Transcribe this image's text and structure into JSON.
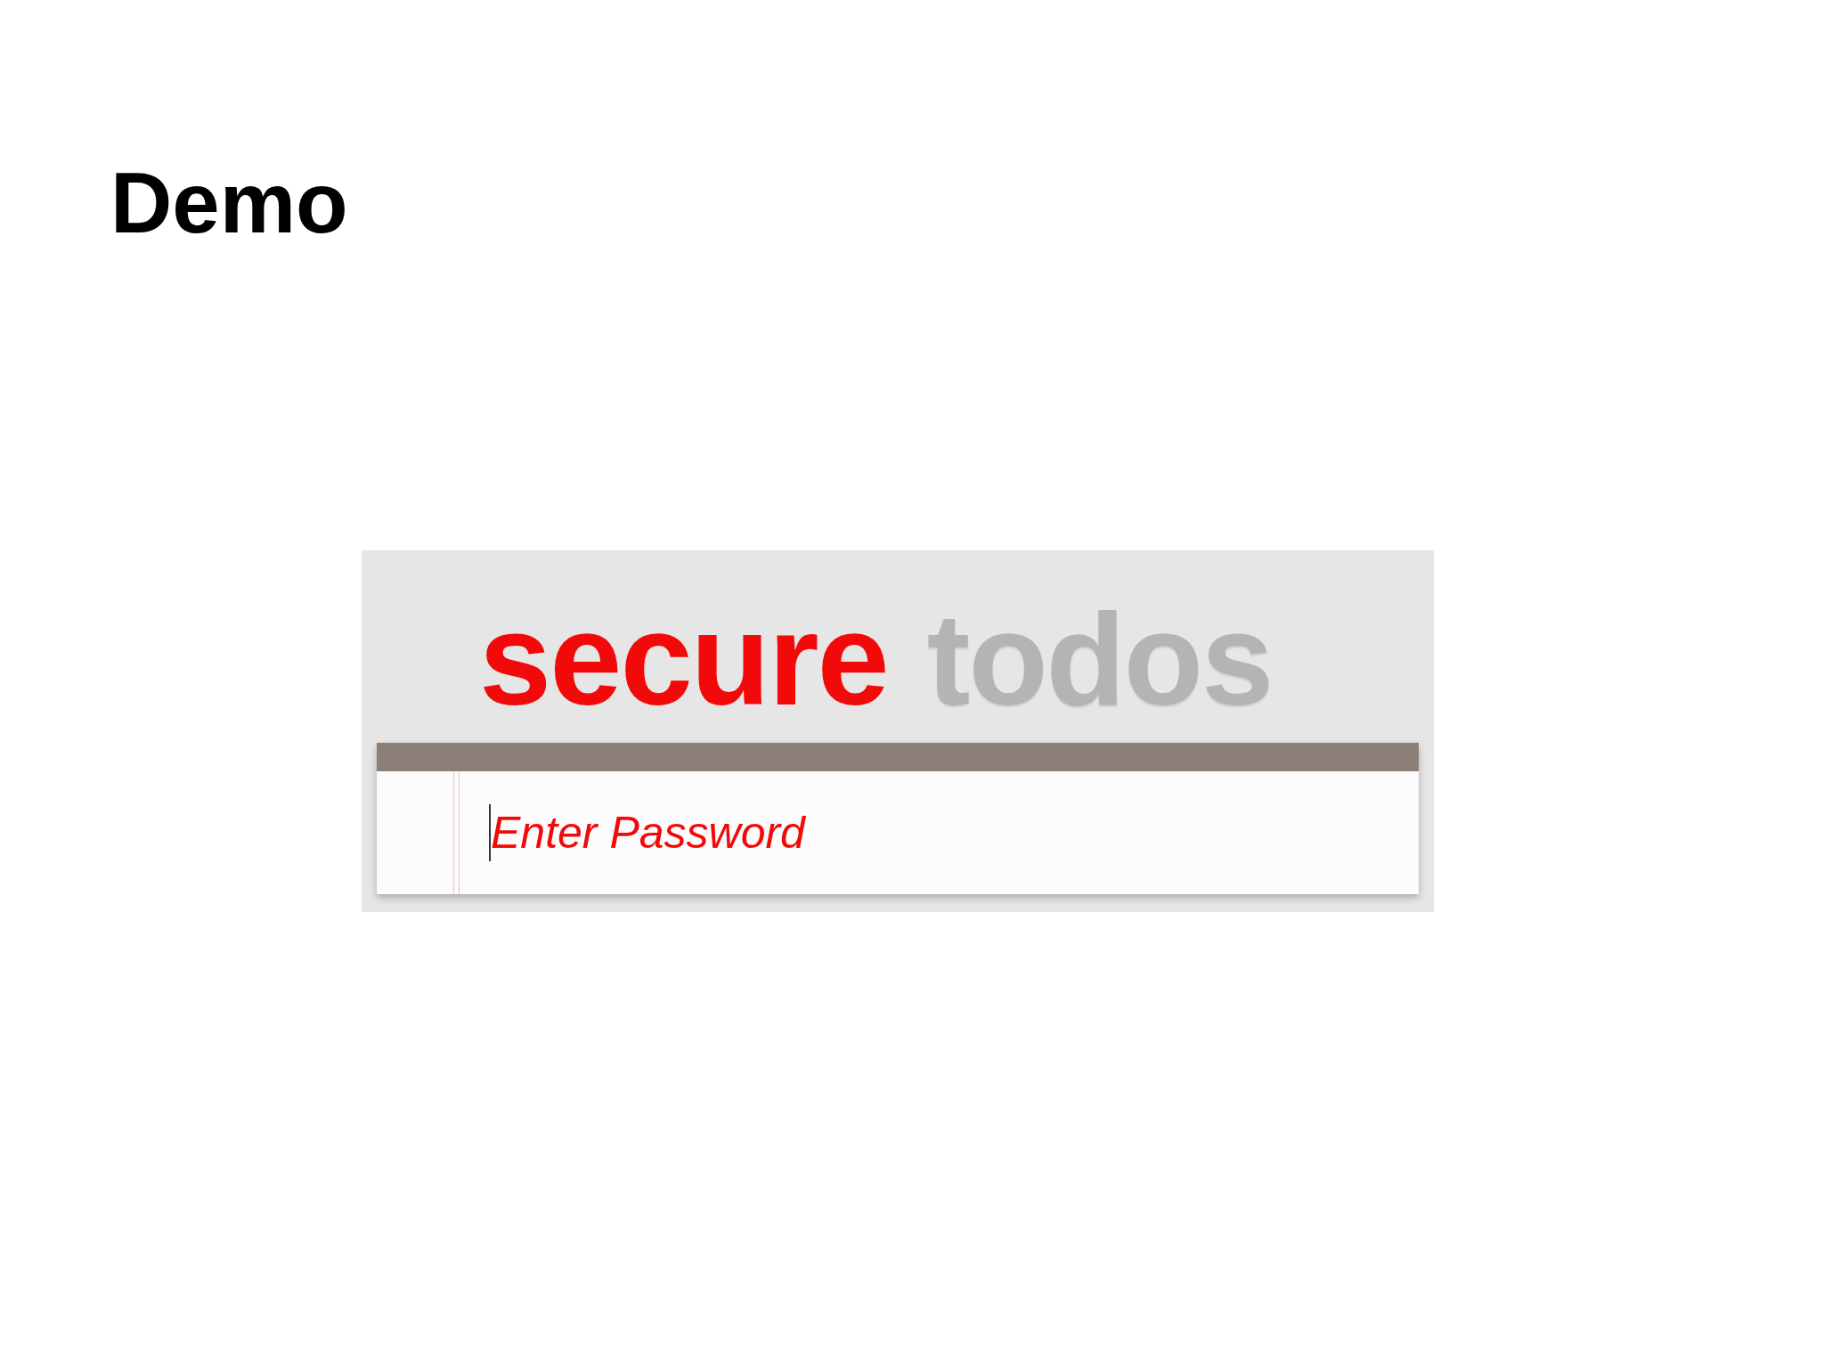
{
  "slide_title": "Demo",
  "app": {
    "logo": {
      "primary": "secure",
      "secondary": "todos"
    },
    "password_field": {
      "placeholder": "Enter Password"
    }
  }
}
